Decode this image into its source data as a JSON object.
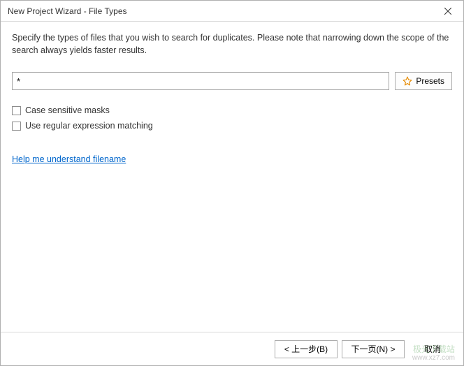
{
  "titlebar": {
    "title": "New Project Wizard - File Types"
  },
  "instructions": "Specify the types of files that you wish to search for duplicates. Please note that narrowing down the scope of the search always yields faster results.",
  "maskInput": {
    "value": "*",
    "placeholder": ""
  },
  "presetsLabel": "Presets",
  "checkboxes": {
    "caseSensitive": {
      "label": "Case sensitive masks",
      "checked": false
    },
    "regex": {
      "label": "Use regular expression matching",
      "checked": false
    }
  },
  "helpLink": "Help me understand filename",
  "footer": {
    "back": "< 上一步(B)",
    "next": "下一页(N) >",
    "cancel": "取消"
  },
  "watermark": {
    "line1": "极光下载站",
    "line2": "www.xz7.com"
  }
}
